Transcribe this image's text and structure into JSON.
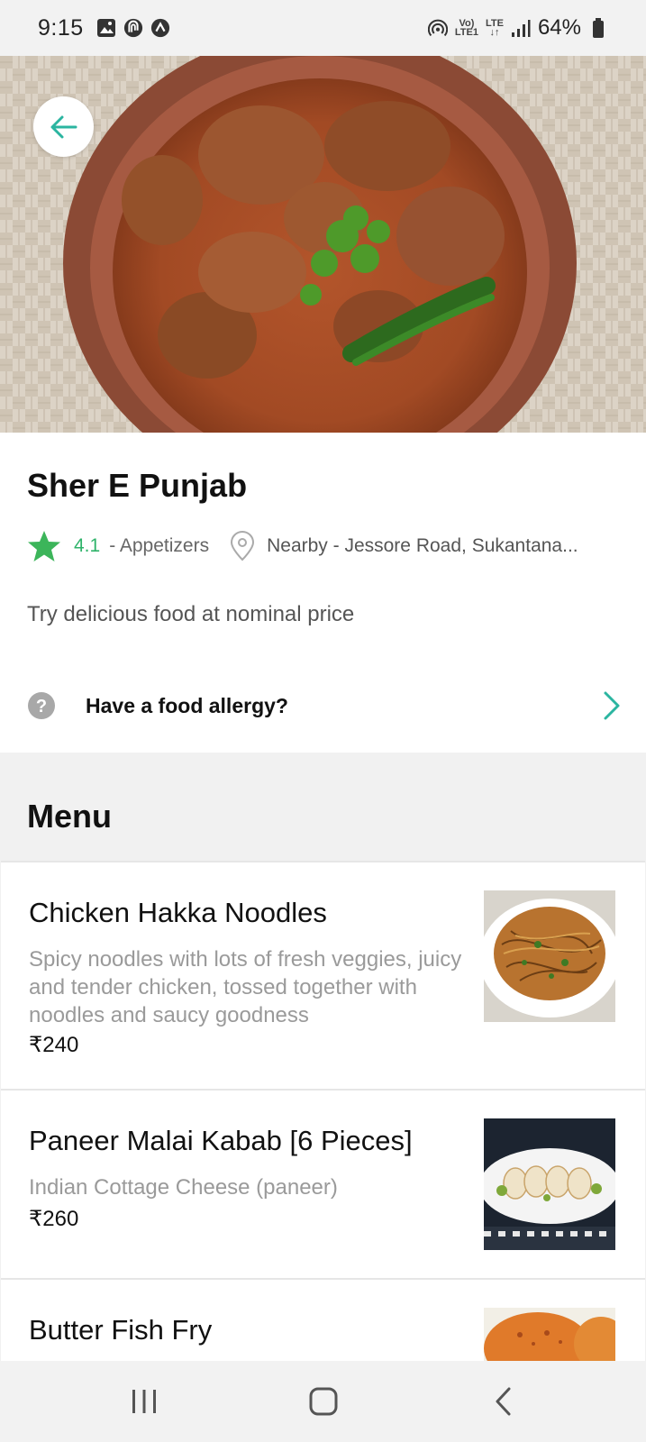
{
  "status_bar": {
    "time": "9:15",
    "lte_label_top": "Vo)",
    "lte_label_bottom": "LTE1",
    "lte_tag": "LTE",
    "battery": "64%"
  },
  "restaurant": {
    "name": "Sher E Punjab",
    "rating": "4.1",
    "category": "- Appetizers",
    "location": "Nearby - Jessore Road, Sukantana...",
    "tagline": "Try delicious food at nominal price",
    "allergy_prompt": "Have a food allergy?"
  },
  "menu": {
    "title": "Menu",
    "items": [
      {
        "name": "Chicken Hakka Noodles",
        "description": "Spicy noodles with lots of fresh veggies, juicy and tender chicken, tossed together with noodles and saucy goodness",
        "price": "₹240"
      },
      {
        "name": "Paneer Malai Kabab [6 Pieces]",
        "description": "Indian Cottage Cheese (paneer)",
        "price": "₹260"
      },
      {
        "name": "Butter Fish Fry",
        "description": "",
        "price": ""
      }
    ]
  },
  "colors": {
    "accent": "#2bb5a0",
    "rating_green": "#2fb36a",
    "section_bg": "#f1f1f1"
  },
  "icons": {
    "back": "arrow-left-icon",
    "star": "star-icon",
    "location": "location-pin-icon",
    "help": "question-circle-icon",
    "chevron": "chevron-right-icon"
  }
}
